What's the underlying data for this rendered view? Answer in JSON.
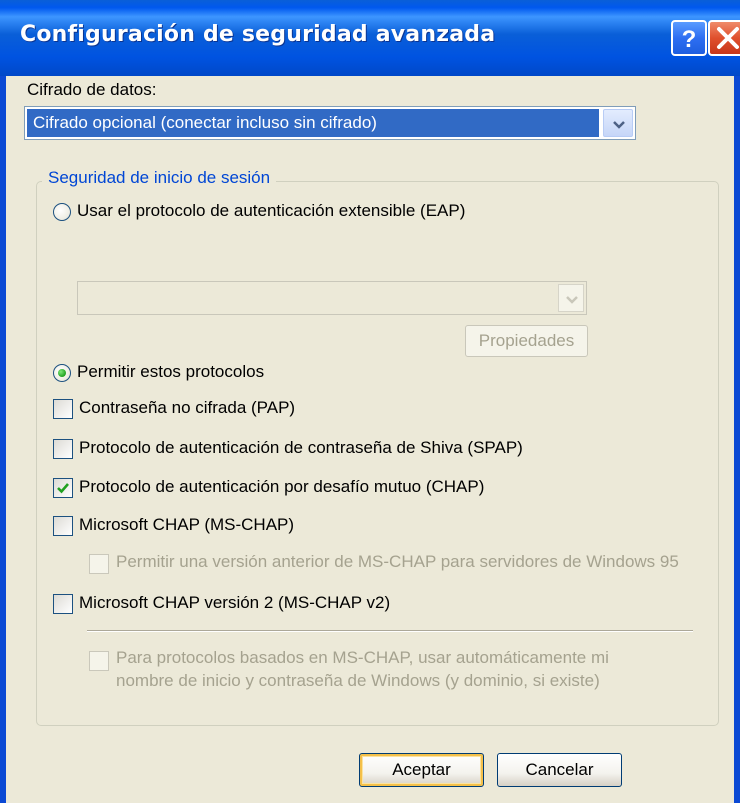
{
  "window": {
    "title": "Configuración de seguridad avanzada",
    "help_label": "?",
    "close_label": "X"
  },
  "data_encryption": {
    "label": "Cifrado de datos:",
    "selected": "Cifrado opcional (conectar incluso sin cifrado)"
  },
  "logon_security": {
    "legend": "Seguridad de inicio de sesión",
    "eap_radio": {
      "label": "Usar el protocolo de autenticación extensible (EAP)",
      "selected": false
    },
    "eap_combo_value": "",
    "properties_button": "Propiedades",
    "allow_radio": {
      "label": "Permitir estos protocolos",
      "selected": true
    },
    "protocols": [
      {
        "label": "Contraseña no cifrada (PAP)",
        "checked": false,
        "enabled": true
      },
      {
        "label": "Protocolo de autenticación de contraseña de Shiva (SPAP)",
        "checked": false,
        "enabled": true
      },
      {
        "label": "Protocolo de autenticación por desafío mutuo (CHAP)",
        "checked": true,
        "enabled": true
      },
      {
        "label": "Microsoft CHAP (MS-CHAP)",
        "checked": false,
        "enabled": true
      },
      {
        "label": "Permitir una versión anterior de MS-CHAP para servidores de Windows 95",
        "checked": false,
        "enabled": false
      },
      {
        "label": "Microsoft CHAP versión 2 (MS-CHAP v2)",
        "checked": false,
        "enabled": true
      }
    ],
    "auto_logon": {
      "line1": "Para protocolos basados en MS-CHAP, usar automáticamente mi",
      "line2": "nombre de inicio y contraseña de Windows (y dominio, si existe)",
      "checked": false,
      "enabled": false
    }
  },
  "buttons": {
    "ok": "Aceptar",
    "cancel": "Cancelar"
  },
  "colors": {
    "title_bar": "#0058ee",
    "dialog_bg": "#ece9d8",
    "selection": "#316ac5",
    "group_legend": "#0046d5",
    "disabled_text": "#a5a28f"
  }
}
